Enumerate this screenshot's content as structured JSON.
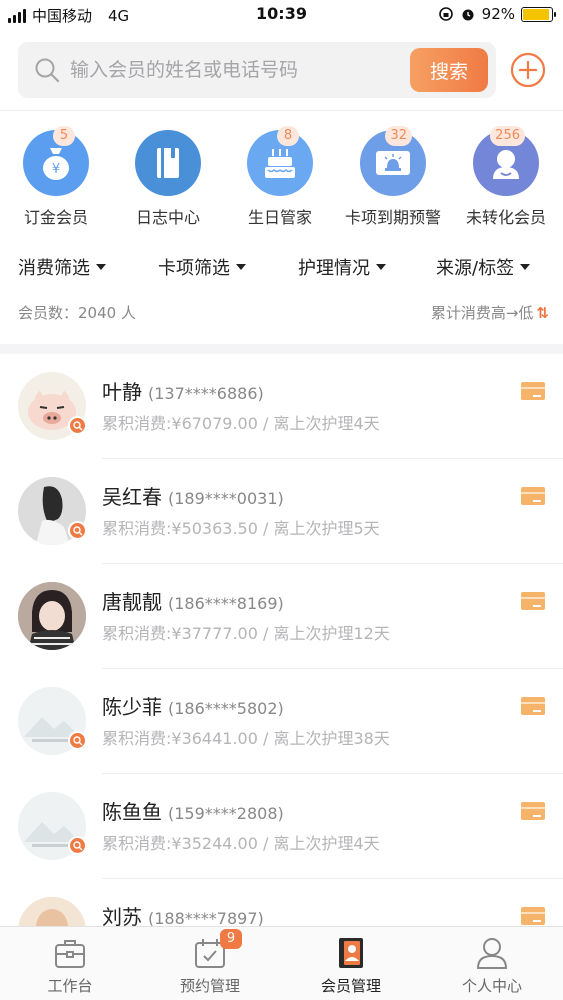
{
  "status_bar": {
    "carrier": "中国移动",
    "network": "4G",
    "time": "10:39",
    "battery": "92%",
    "battery_level": 0.92
  },
  "search": {
    "placeholder": "输入会员的姓名或电话号码",
    "button_label": "搜索"
  },
  "shortcuts": [
    {
      "label": "订金会员",
      "badge": "5",
      "icon": "money-bag-icon",
      "color": "#5b9ef0"
    },
    {
      "label": "日志中心",
      "badge": "",
      "icon": "book-icon",
      "color": "#4a90d9"
    },
    {
      "label": "生日管家",
      "badge": "8",
      "icon": "cake-icon",
      "color": "#6aa8f2"
    },
    {
      "label": "卡项到期预警",
      "badge": "32",
      "icon": "alarm-card-icon",
      "color": "#6e9ee8"
    },
    {
      "label": "未转化会员",
      "badge": "256",
      "icon": "user-icon",
      "color": "#7486d8"
    }
  ],
  "filters": [
    "消费筛选",
    "卡项筛选",
    "护理情况",
    "来源/标签"
  ],
  "summary": {
    "count_text": "会员数：2040 人",
    "sort_text": "累计消费高→低"
  },
  "members": [
    {
      "name": "叶静",
      "phone": "(137****6886)",
      "desc": "累积消费:¥67079.00 / 离上次护理4天",
      "avatar": "pig"
    },
    {
      "name": "吴红春",
      "phone": "(189****0031)",
      "desc": "累积消费:¥50363.50 / 离上次护理5天",
      "avatar": "girl-white"
    },
    {
      "name": "唐靓靓",
      "phone": "(186****8169)",
      "desc": "累积消费:¥37777.00 / 离上次护理12天",
      "avatar": "girl-dark"
    },
    {
      "name": "陈少菲",
      "phone": "(186****5802)",
      "desc": "累积消费:¥36441.00 / 离上次护理38天",
      "avatar": "placeholder"
    },
    {
      "name": "陈鱼鱼",
      "phone": "(159****2808)",
      "desc": "累积消费:¥35244.00 / 离上次护理4天",
      "avatar": "placeholder"
    },
    {
      "name": "刘苏",
      "phone": "(188****7897)",
      "desc": "",
      "avatar": "face"
    }
  ],
  "tabs": [
    {
      "label": "工作台",
      "icon": "briefcase-icon",
      "badge": ""
    },
    {
      "label": "预约管理",
      "icon": "calendar-check-icon",
      "badge": "9"
    },
    {
      "label": "会员管理",
      "icon": "member-card-icon",
      "badge": "",
      "active": true
    },
    {
      "label": "个人中心",
      "icon": "person-icon",
      "badge": ""
    }
  ],
  "colors": {
    "accent": "#f07a44",
    "card_icon": "#f6b36a",
    "badge_bg": "#fde7dc"
  }
}
